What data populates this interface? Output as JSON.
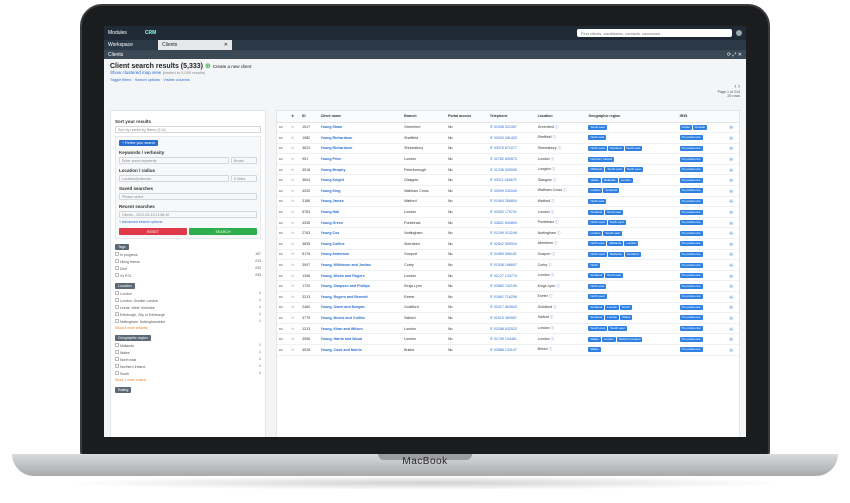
{
  "topbar": {
    "modules": "Modules",
    "logo": "CRM",
    "search_placeholder": "Find clients, candidates, contacts, vacancies..."
  },
  "tabbar": {
    "workspace": "Workspace",
    "tab": "Clients"
  },
  "subbar": {
    "title": "Clients"
  },
  "page": {
    "title": "Client search results (5,333)",
    "create": "Create a new client",
    "map": "Show clustered map view",
    "map_note": "(limited to 5,000 results)",
    "links": [
      "Toggle filters",
      "Search options",
      "Visible columns"
    ],
    "pagination": "Page 1 of 214",
    "pag2": "25 rows"
  },
  "left": {
    "sort_title": "Sort your results",
    "sort_value": "Sort by results by Name (Z-A)",
    "refine": "+ Refine your search",
    "keywords_label": "Keywords / verbosity",
    "keywords_ph": "Enter some keywords",
    "broad": "Broad",
    "location_label": "Location / radius",
    "location_ph": "Location/postcode",
    "radius": "5 Miles",
    "saved_label": "Saved searches",
    "saved_ph": "Please select",
    "recent_label": "Recent searches",
    "recent_value": "Clients - 2021-05-19 11:58:40",
    "advanced": "+ Advanced search options",
    "reset": "RESET",
    "search": "SEARCH",
    "facets": [
      {
        "title": "Tags",
        "items": [
          [
            "In progress",
            "107"
          ],
          [
            "Hiring freeze",
            "213"
          ],
          [
            "Dive",
            "232"
          ],
          [
            "Vs PSL",
            "233"
          ]
        ],
        "more": ""
      },
      {
        "title": "Location",
        "items": [
          [
            "London",
            "1"
          ],
          [
            "London, Greater London",
            "1"
          ],
          [
            "Leeds, West Yorkshire",
            "1"
          ],
          [
            "Edinburgh, City of Edinburgh",
            "1"
          ],
          [
            "Nottingham, Nottinghamshire",
            "1"
          ]
        ],
        "more": "Show 8 more choices"
      },
      {
        "title": "Geographic region",
        "items": [
          [
            "Midlands",
            "1"
          ],
          [
            "Wales",
            "1"
          ],
          [
            "North east",
            "1"
          ],
          [
            "Northern Ireland",
            "1"
          ],
          [
            "South",
            "1"
          ]
        ],
        "more": "Show 1 more choice"
      },
      {
        "title": "Rating",
        "items": [],
        "more": ""
      }
    ]
  },
  "table": {
    "headers": [
      "",
      "★",
      "ID",
      "Client name",
      "Branch",
      "Portal access",
      "Telephone",
      "Location",
      "Geographic region",
      "IR35",
      ""
    ],
    "rows": [
      [
        "1517",
        "Young Shaw",
        "Greenford",
        "No",
        "01908 321067",
        "Greenford",
        [
          "South east"
        ],
        [
          "Inside",
          "Outside"
        ]
      ],
      [
        "1982",
        "Young Richardson",
        "Sheffield",
        "No",
        "02003 081433",
        "Sheffield",
        [
          "North east"
        ],
        [
          "No preference"
        ]
      ],
      [
        "3623",
        "Young Richardson",
        "Shrewsbury",
        "No",
        "03376 871077",
        "Shrewsbury",
        [
          "North west",
          "Scotland",
          "North east"
        ],
        [
          "No preference"
        ]
      ],
      [
        "951",
        "Young Price",
        "London",
        "No",
        "02782 805573",
        "London",
        [
          "Northern Ireland"
        ],
        [
          "No preference"
        ]
      ],
      [
        "3018",
        "Young Murphy",
        "Peterborough",
        "No",
        "01236 505009",
        "Longton",
        [
          "Midlands",
          "South east",
          "North east"
        ],
        [
          "No preference"
        ]
      ],
      [
        "3604",
        "Young Knight",
        "Glasgow",
        "No",
        "03311 464679",
        "Glasgow",
        [
          "Wales",
          "Midlands",
          "London"
        ],
        [
          "No preference"
        ]
      ],
      [
        "4025",
        "Young King",
        "Waltham Cross",
        "No",
        "02909 032040",
        "Waltham Cross",
        [
          "London",
          "Scotland"
        ],
        [
          "No preference"
        ]
      ],
      [
        "3186",
        "Young James",
        "Watford",
        "No",
        "01904 266804",
        "Watford",
        [
          "North east"
        ],
        [
          "No preference"
        ]
      ],
      [
        "5763",
        "Young Hall",
        "London",
        "No",
        "03452 179741",
        "London",
        [
          "Scotland",
          "North east"
        ],
        [
          "No preference"
        ]
      ],
      [
        "4335",
        "Young Green",
        "Pontefract",
        "No",
        "03831 640809",
        "Pontefract",
        [
          "North west",
          "North east"
        ],
        [
          "No preference"
        ]
      ],
      [
        "2763",
        "Young Cox",
        "Nottingham",
        "No",
        "01299 013248",
        "Nottingham",
        [
          "London",
          "South east"
        ],
        [
          "No preference"
        ]
      ],
      [
        "3835",
        "Young Collins",
        "Aberdeen",
        "No",
        "02842 559904",
        "Aberdeen",
        [
          "North east",
          "Midlands",
          "London"
        ],
        [
          "No preference"
        ]
      ],
      [
        "5175",
        "Young Anderson",
        "Gosport",
        "No",
        "01869 656181",
        "Gosport",
        [
          "North west",
          "Midlands",
          "Scotland"
        ],
        [
          "No preference"
        ]
      ],
      [
        "3007",
        "Young, Wilkinson and Jordan",
        "Corby",
        "No",
        "01538 196697",
        "Corby",
        [
          "North"
        ],
        [
          "No preference"
        ]
      ],
      [
        "1346",
        "Young, Wicks and Rogers",
        "London",
        "No",
        "02127 133774",
        "London",
        [
          "Scotland",
          "North east"
        ],
        [
          "No preference"
        ]
      ],
      [
        "1720",
        "Young, Simpson and Phillips",
        "Kings Lynn",
        "No",
        "02680 742109",
        "Kings Lynn",
        [
          "North east"
        ],
        [
          "No preference"
        ]
      ],
      [
        "3313",
        "Young, Rogers and Bennett",
        "Exeter",
        "No",
        "01861 716256",
        "Exeter",
        [
          "North west"
        ],
        [
          "No preference"
        ]
      ],
      [
        "2460",
        "Young, Owen and Morgan",
        "Guildford",
        "No",
        "02417 863843",
        "Guildford",
        [
          "Scotland",
          "London",
          "North"
        ],
        [
          "No preference"
        ]
      ],
      [
        "3779",
        "Young, Morris and Collins",
        "Salford",
        "No",
        "01510 460067",
        "Salford",
        [
          "Scotland",
          "London",
          "Wales"
        ],
        [
          "No preference"
        ]
      ],
      [
        "1313",
        "Young, Khan and Wilson",
        "London",
        "No",
        "03286 932523",
        "London",
        [
          "South west",
          "South east"
        ],
        [
          "No preference"
        ]
      ],
      [
        "3906",
        "Young, Harris and Wood",
        "London",
        "No",
        "01705 104461",
        "London",
        [
          "Wales",
          "London",
          "Northern Ireland"
        ],
        [
          "No preference"
        ]
      ],
      [
        "4028",
        "Young, Cook and Morris",
        "Bristol",
        "No",
        "03888 133147",
        "Bristol",
        [
          "Wales"
        ],
        [
          "No preference"
        ]
      ]
    ]
  },
  "brand": "MacBook"
}
